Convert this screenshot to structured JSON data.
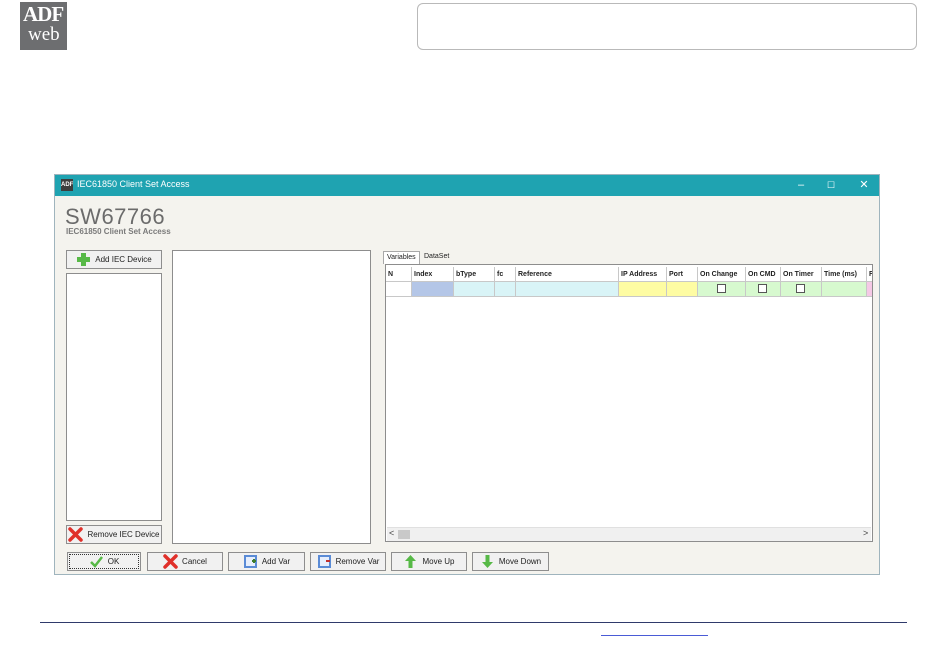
{
  "logo": {
    "line1": "ADF",
    "line2": "web"
  },
  "window": {
    "title": "IEC61850 Client Set Access",
    "controls": {
      "minimize": "–",
      "maximize": "☐",
      "close": "✕"
    },
    "heading": "SW67766",
    "subheading": "IEC61850 Client Set Access"
  },
  "left": {
    "add_label": "Add IEC Device",
    "remove_label": "Remove IEC Device"
  },
  "tabs": [
    {
      "label": "Variables",
      "active": true
    },
    {
      "label": "DataSet",
      "active": false
    }
  ],
  "grid": {
    "columns": [
      "N",
      "Index",
      "bType",
      "fc",
      "Reference",
      "IP Address",
      "Port",
      "On Change",
      "On CMD",
      "On Timer",
      "Time (ms)",
      "F"
    ]
  },
  "scroll": {
    "left": "<",
    "right": ">"
  },
  "buttons": {
    "ok": "OK",
    "cancel": "Cancel",
    "add_var": "Add Var",
    "remove_var": "Remove Var",
    "move_up": "Move Up",
    "move_down": "Move Down"
  },
  "colors": {
    "titlebar": "#1fa3b1",
    "index_cell": "#b4c6e7",
    "cyan_cell": "#d9f4f7",
    "yellow_cell": "#fefca3",
    "green_cell": "#d7f9cf",
    "pink_cell": "#f5c9e6"
  }
}
